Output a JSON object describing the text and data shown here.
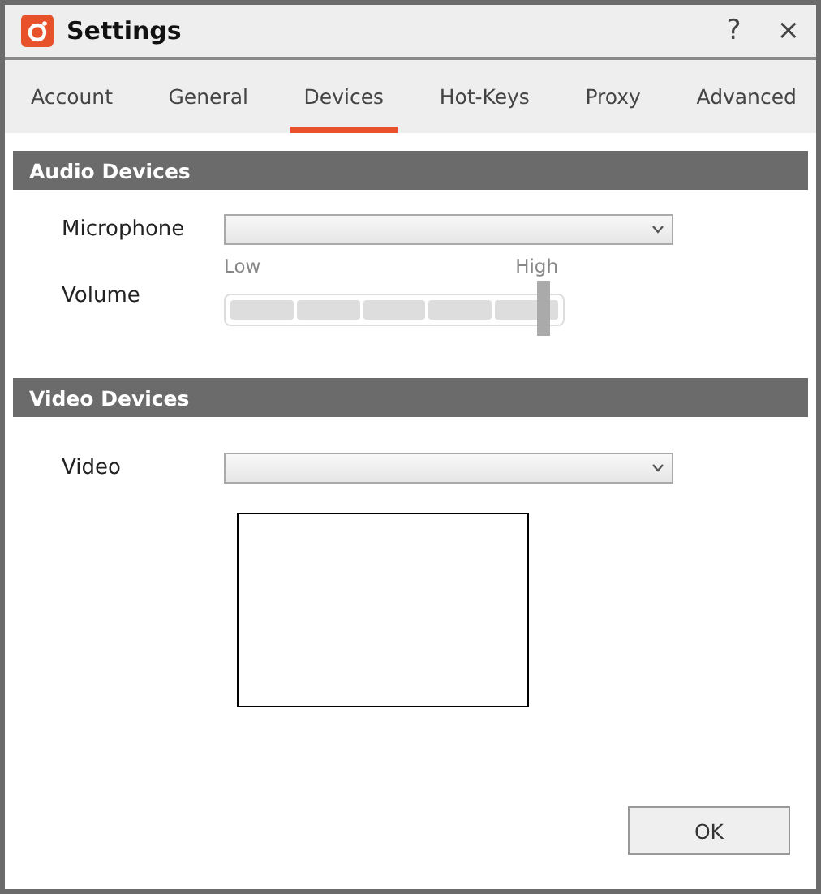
{
  "window": {
    "title": "Settings",
    "help": "?",
    "close": "×"
  },
  "tabs": [
    {
      "label": "Account",
      "selected": false
    },
    {
      "label": "General",
      "selected": false
    },
    {
      "label": "Devices",
      "selected": true
    },
    {
      "label": "Hot-Keys",
      "selected": false
    },
    {
      "label": "Proxy",
      "selected": false
    },
    {
      "label": "Advanced",
      "selected": false
    }
  ],
  "audio": {
    "title": "Audio Devices",
    "microphone_label": "Microphone",
    "volume_label": "Volume",
    "low_label": "Low",
    "high_label": "High",
    "volume": {
      "level": 0.94
    }
  },
  "video": {
    "title": "Video Devices",
    "video_label": "Video"
  },
  "buttons": [
    "OK"
  ]
}
